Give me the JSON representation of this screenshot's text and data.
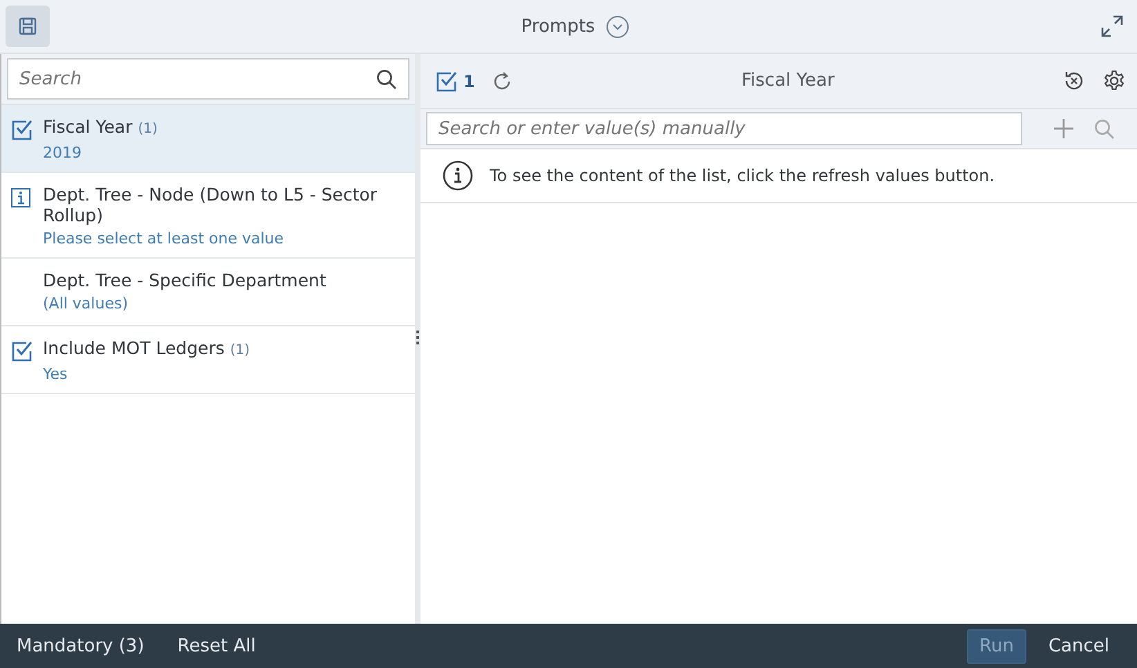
{
  "dialog": {
    "title": "Prompts"
  },
  "search": {
    "placeholder": "Search"
  },
  "prompts": [
    {
      "kind": "checked",
      "label": "Fiscal Year",
      "count": "(1)",
      "value": "2019",
      "selected": true
    },
    {
      "kind": "info",
      "label": "Dept. Tree - Node (Down to L5 - Sector Rollup)",
      "value": "Please select at least one value",
      "selected": false
    },
    {
      "kind": "none",
      "label": "Dept. Tree - Specific Department",
      "value": "(All values)",
      "selected": false
    },
    {
      "kind": "checked",
      "label": "Include MOT Ledgers",
      "count": "(1)",
      "value": "Yes",
      "selected": false
    }
  ],
  "detail": {
    "selected_count": "1",
    "title": "Fiscal Year",
    "value_placeholder": "Search or enter value(s) manually",
    "message": "To see the content of the list, click the refresh values button."
  },
  "footer": {
    "mandatory": "Mandatory (3)",
    "reset": "Reset All",
    "run": {
      "label": "Run",
      "disabled": true
    },
    "cancel": "Cancel"
  }
}
